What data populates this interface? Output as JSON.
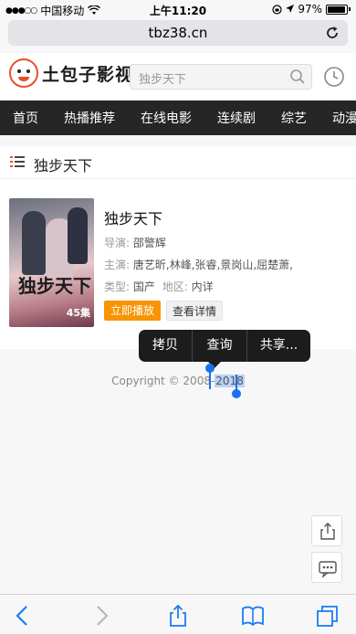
{
  "status_bar": {
    "carrier": "中国移动",
    "time": "上午11:20",
    "battery": "97%"
  },
  "address_bar": {
    "url": "tbz38.cn"
  },
  "site": {
    "logo_text": "土包子影视",
    "search_placeholder": "独步天下",
    "nav": [
      "首页",
      "热播推荐",
      "在线电影",
      "连续剧",
      "综艺",
      "动漫"
    ]
  },
  "section": {
    "title": "独步天下"
  },
  "movie": {
    "title": "独步天下",
    "director_label": "导演:",
    "director": "邵警辉",
    "cast_label": "主演:",
    "cast": "唐艺昕,林峰,张睿,景岗山,屈楚萧,",
    "type_label": "类型:",
    "type": "国产",
    "region_label": "地区:",
    "region": "内详",
    "poster_calligraphy": "独步天下",
    "poster_episodes": "45集",
    "play_label": "立即播放",
    "detail_label": "查看详情"
  },
  "context_menu": {
    "items": [
      "拷贝",
      "查询",
      "共享..."
    ]
  },
  "footer": {
    "copyright_prefix": "Copyright © 2008-",
    "copyright_year": "2018"
  },
  "icons": {
    "reload": "reload-icon",
    "search": "search-icon",
    "history": "clock-icon",
    "list": "list-icon",
    "share_float": "share-icon",
    "chat_float": "chat-icon",
    "back": "back-icon",
    "forward": "forward-icon",
    "share": "share-icon",
    "bookmarks": "book-icon",
    "tabs": "tabs-icon"
  },
  "colors": {
    "nav_bg": "#262626",
    "accent_orange": "#f89406",
    "selection_blue": "#1c6ef2",
    "ios_blue": "#1a7cf5"
  }
}
